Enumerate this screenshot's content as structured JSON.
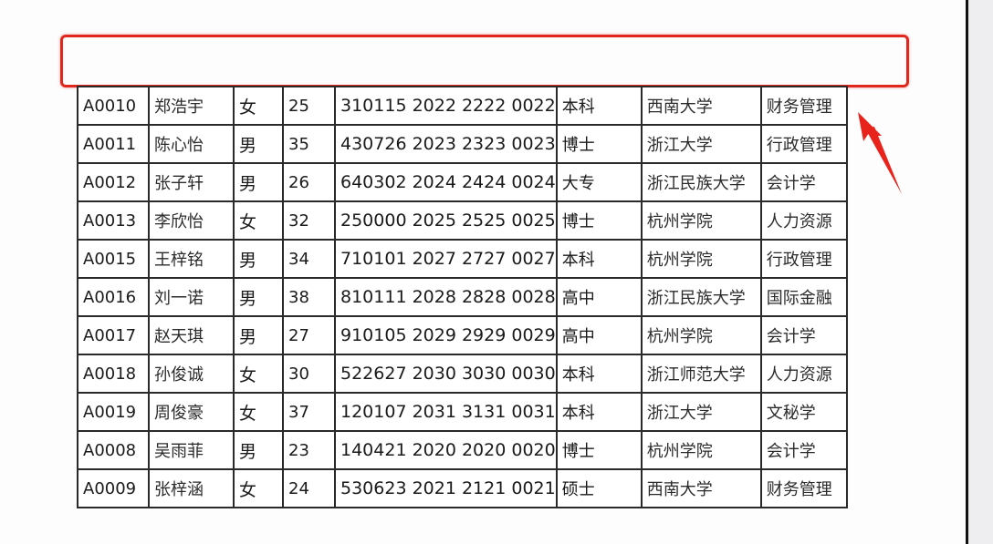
{
  "annotation": {
    "highlight_color": "#e0271d",
    "arrow_icon": "red-arrow-pointing-up-left"
  },
  "table": {
    "rows": [
      {
        "id": "A0010",
        "name": "郑浩宇",
        "gender": "女",
        "age": "25",
        "id_number": "310115 2022 2222 0022",
        "education": "本科",
        "school": "西南大学",
        "major": "财务管理"
      },
      {
        "id": "A0011",
        "name": "陈心怡",
        "gender": "男",
        "age": "35",
        "id_number": "430726 2023 2323 0023",
        "education": "博士",
        "school": "浙江大学",
        "major": "行政管理"
      },
      {
        "id": "A0012",
        "name": "张子轩",
        "gender": "男",
        "age": "26",
        "id_number": "640302 2024 2424 0024",
        "education": "大专",
        "school": "浙江民族大学",
        "major": "会计学"
      },
      {
        "id": "A0013",
        "name": "李欣怡",
        "gender": "女",
        "age": "32",
        "id_number": "250000 2025 2525 0025",
        "education": "博士",
        "school": "杭州学院",
        "major": "人力资源"
      },
      {
        "id": "A0015",
        "name": "王梓铭",
        "gender": "男",
        "age": "34",
        "id_number": "710101 2027 2727 0027",
        "education": "本科",
        "school": "杭州学院",
        "major": "行政管理"
      },
      {
        "id": "A0016",
        "name": "刘一诺",
        "gender": "男",
        "age": "38",
        "id_number": "810111 2028 2828 0028",
        "education": "高中",
        "school": "浙江民族大学",
        "major": "国际金融"
      },
      {
        "id": "A0017",
        "name": "赵天琪",
        "gender": "男",
        "age": "27",
        "id_number": "910105 2029 2929 0029",
        "education": "高中",
        "school": "杭州学院",
        "major": "会计学"
      },
      {
        "id": "A0018",
        "name": "孙俊诚",
        "gender": "女",
        "age": "30",
        "id_number": "522627 2030 3030 0030",
        "education": "本科",
        "school": "浙江师范大学",
        "major": "人力资源"
      },
      {
        "id": "A0019",
        "name": "周俊豪",
        "gender": "女",
        "age": "37",
        "id_number": "120107 2031 3131 0031",
        "education": "本科",
        "school": "浙江大学",
        "major": "文秘学"
      },
      {
        "id": "A0008",
        "name": "吴雨菲",
        "gender": "男",
        "age": "23",
        "id_number": "140421 2020 2020 0020",
        "education": "博士",
        "school": "杭州学院",
        "major": "会计学"
      },
      {
        "id": "A0009",
        "name": "张梓涵",
        "gender": "女",
        "age": "24",
        "id_number": "530623 2021 2121 0021",
        "education": "硕士",
        "school": "西南大学",
        "major": "财务管理"
      }
    ]
  }
}
